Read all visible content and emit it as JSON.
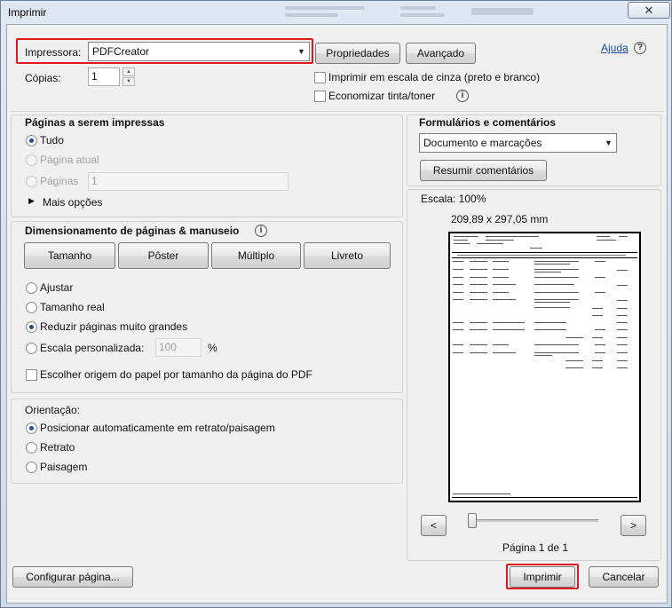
{
  "window": {
    "title": "Imprimir",
    "close_icon": "close-icon"
  },
  "printer": {
    "label": "Impressora:",
    "value": "PDFCreator"
  },
  "buttons": {
    "properties": "Propriedades",
    "advanced": "Avançado",
    "help": "Ajuda",
    "summarize_comments": "Resumir comentários",
    "page_setup": "Configurar página...",
    "print": "Imprimir",
    "cancel": "Cancelar"
  },
  "copies": {
    "label": "Cópias:",
    "value": "1"
  },
  "options": {
    "grayscale": {
      "label": "Imprimir em escala de cinza (preto e branco)",
      "checked": false
    },
    "save_ink": {
      "label": "Economizar tinta/toner",
      "checked": false
    }
  },
  "pages_to_print": {
    "title": "Páginas a serem impressas",
    "all": "Tudo",
    "current": "Página atual",
    "pages": "Páginas",
    "pages_value": "1",
    "more": "Mais opções",
    "selected": "all"
  },
  "sizing": {
    "title": "Dimensionamento de páginas & manuseio",
    "tabs": [
      "Tamanho",
      "Pôster",
      "Múltiplo",
      "Livreto"
    ],
    "fit": "Ajustar",
    "actual": "Tamanho real",
    "shrink": "Reduzir páginas muito grandes",
    "custom": "Escala personalizada:",
    "custom_value": "100",
    "percent": "%",
    "source": "Escolher origem do papel por tamanho da página do PDF",
    "selected": "shrink"
  },
  "orientation": {
    "title": "Orientação:",
    "auto": "Posicionar automaticamente em retrato/paisagem",
    "portrait": "Retrato",
    "landscape": "Paisagem",
    "selected": "auto"
  },
  "forms": {
    "title": "Formulários e comentários",
    "value": "Documento e marcações"
  },
  "preview": {
    "scale": "Escala: 100%",
    "dimensions": "209,89 x 297,05 mm",
    "page_info": "Página 1 de 1",
    "prev": "<",
    "next": ">",
    "zoom_level": 0.0
  }
}
